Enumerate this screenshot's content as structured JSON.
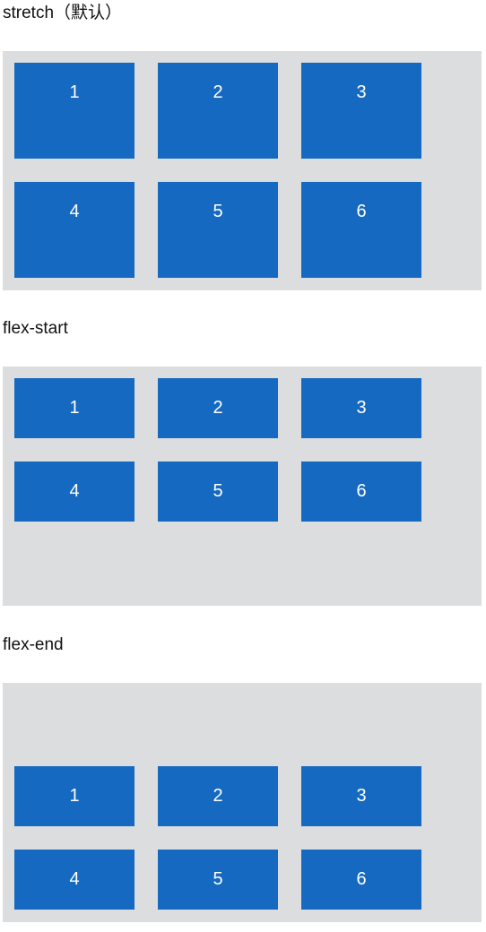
{
  "sections": [
    {
      "title": "stretch（默认）",
      "items": [
        "1",
        "2",
        "3",
        "4",
        "5",
        "6"
      ]
    },
    {
      "title": "flex-start",
      "items": [
        "1",
        "2",
        "3",
        "4",
        "5",
        "6"
      ]
    },
    {
      "title": "flex-end",
      "items": [
        "1",
        "2",
        "3",
        "4",
        "5",
        "6"
      ]
    }
  ],
  "colors": {
    "item_background": "#1569c1",
    "container_background": "#dcdddf",
    "item_text": "#ffffff"
  }
}
